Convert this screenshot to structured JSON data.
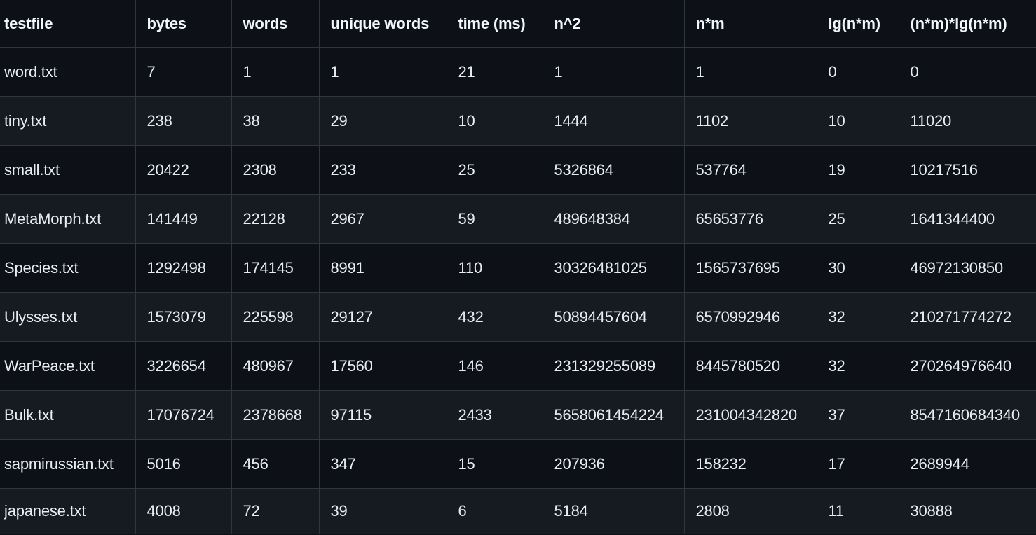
{
  "table": {
    "columns": [
      "testfile",
      "bytes",
      "words",
      "unique words",
      "time (ms)",
      "n^2",
      "n*m",
      "lg(n*m)",
      "(n*m)*lg(n*m)"
    ],
    "rows": [
      [
        "word.txt",
        "7",
        "1",
        "1",
        "21",
        "1",
        "1",
        "0",
        "0"
      ],
      [
        "tiny.txt",
        "238",
        "38",
        "29",
        "10",
        "1444",
        "1102",
        "10",
        "11020"
      ],
      [
        "small.txt",
        "20422",
        "2308",
        "233",
        "25",
        "5326864",
        "537764",
        "19",
        "10217516"
      ],
      [
        "MetaMorph.txt",
        "141449",
        "22128",
        "2967",
        "59",
        "489648384",
        "65653776",
        "25",
        "1641344400"
      ],
      [
        "Species.txt",
        "1292498",
        "174145",
        "8991",
        "110",
        "30326481025",
        "1565737695",
        "30",
        "46972130850"
      ],
      [
        "Ulysses.txt",
        "1573079",
        "225598",
        "29127",
        "432",
        "50894457604",
        "6570992946",
        "32",
        "210271774272"
      ],
      [
        "WarPeace.txt",
        "3226654",
        "480967",
        "17560",
        "146",
        "231329255089",
        "8445780520",
        "32",
        "270264976640"
      ],
      [
        "Bulk.txt",
        "17076724",
        "2378668",
        "97115",
        "2433",
        "5658061454224",
        "231004342820",
        "37",
        "8547160684340"
      ],
      [
        "sapmirussian.txt",
        "5016",
        "456",
        "347",
        "15",
        "207936",
        "158232",
        "17",
        "2689944"
      ],
      [
        "japanese.txt",
        "4008",
        "72",
        "39",
        "6",
        "5184",
        "2808",
        "11",
        "30888"
      ]
    ]
  },
  "colors": {
    "background": "#0d1117",
    "row_alt": "#161b22",
    "border": "#30363d",
    "text": "#e6edf3"
  }
}
